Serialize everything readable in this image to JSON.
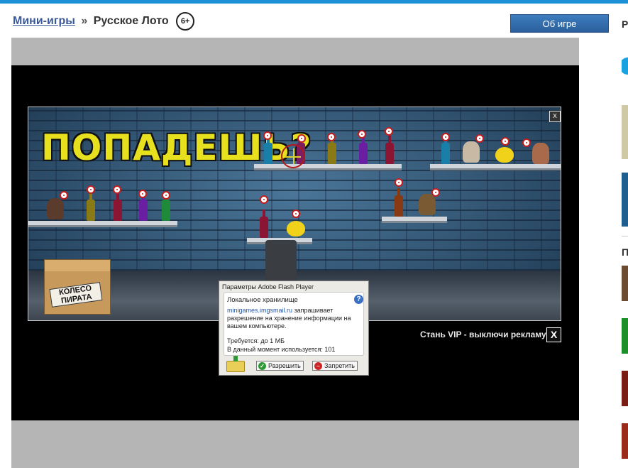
{
  "header": {
    "breadcrumb_link": "Мини-игры",
    "breadcrumb_separator": "»",
    "title": "Русское Лото",
    "age_rating": "6+",
    "about_button": "Об игре"
  },
  "sidebar": {
    "letter_top": "Р",
    "letter_mid": "П"
  },
  "game": {
    "banner_text": "ПОПАДЕШЬ?",
    "box_label": "КОЛЕСО ПИРАТА",
    "close_label": "x"
  },
  "ad": {
    "vip_text": "Стань VIP - выключи рекламу",
    "close_label": "X"
  },
  "flash_dialog": {
    "title": "Параметры Adobe Flash Player",
    "heading": "Локальное хранилище",
    "host": "minigames.imgsmail.ru",
    "message_rest": " запрашивает разрешение на хранение информации на вашем компьютере.",
    "required": "Требуется: до 1 МБ",
    "in_use": "В данный момент используется: 101",
    "allow_label": "Разрешить",
    "deny_label": "Запретить",
    "help_label": "?"
  },
  "colors": {
    "accent_bar": "#1c8fd6",
    "link": "#3b5998",
    "about_button": "#2f6aa8",
    "banner_text": "#e6e01f"
  }
}
